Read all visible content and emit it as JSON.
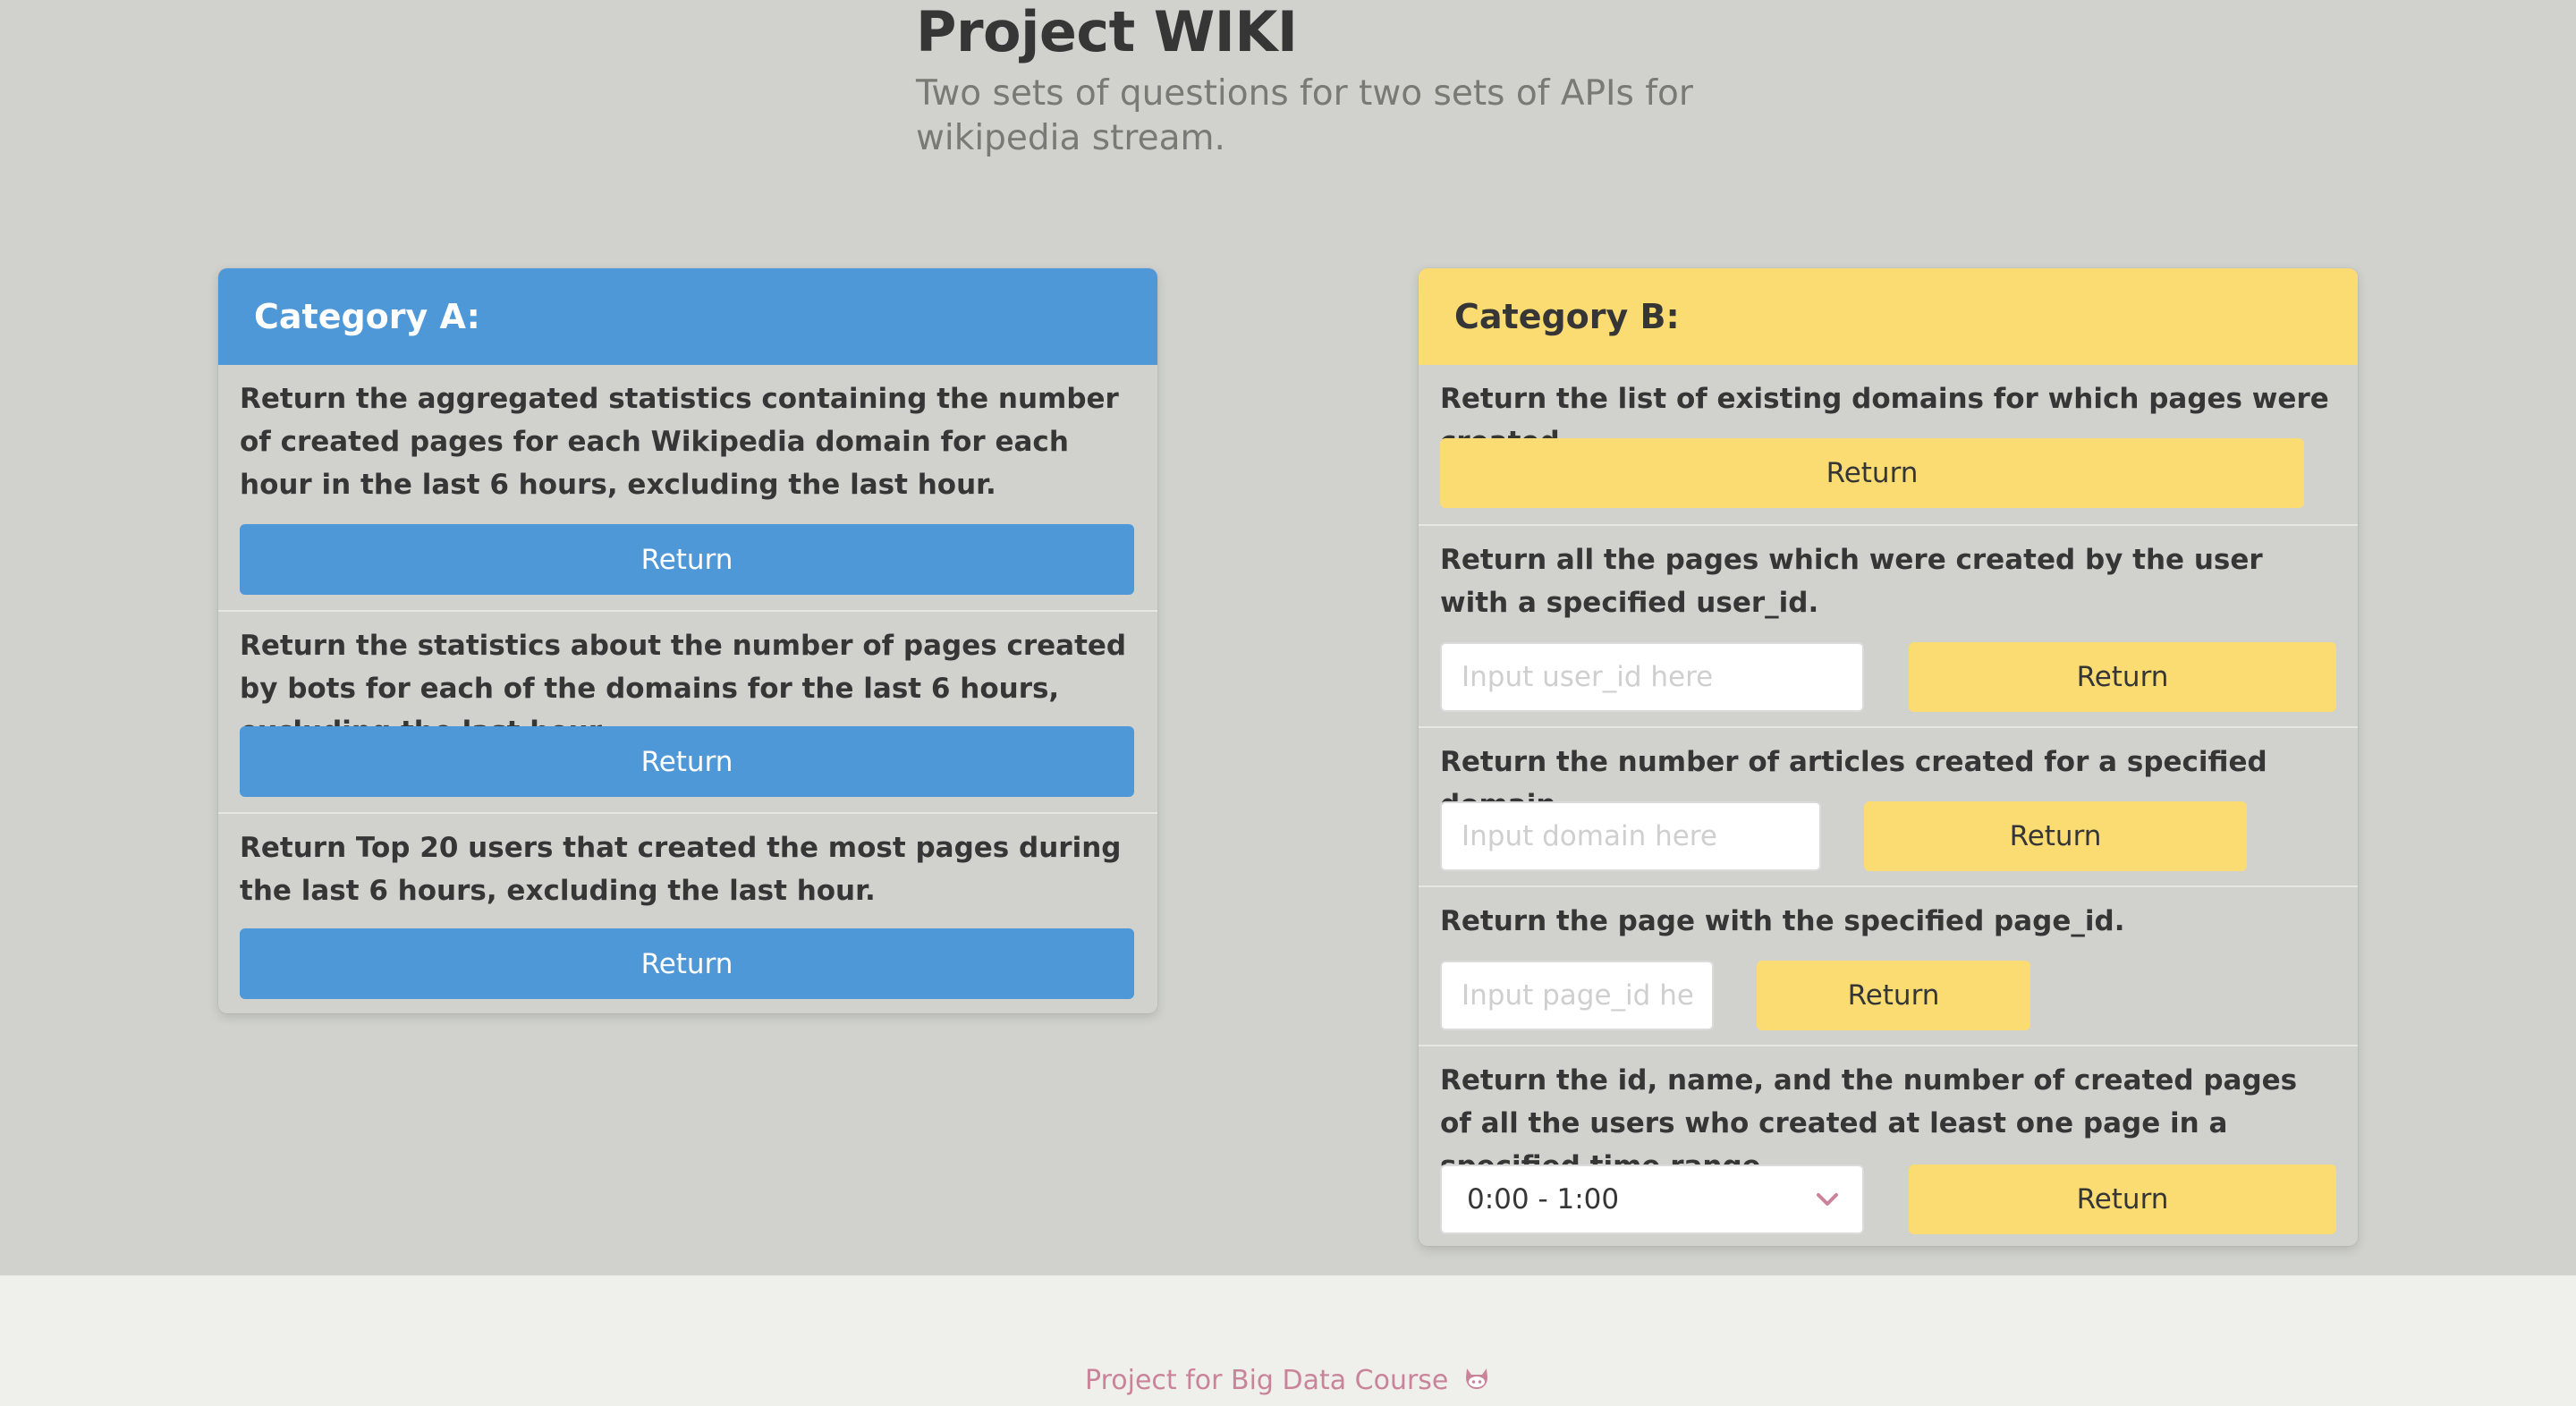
{
  "header": {
    "title": "Project WIKI",
    "subtitle": "Two sets of questions for two sets of APIs for wikipedia stream."
  },
  "category_a": {
    "title": "Category A:",
    "accent_color": "#4f98d8",
    "items": [
      {
        "question": "Return the aggregated statistics containing the number of created pages for each Wikipedia domain for each hour in the last 6 hours, excluding the last hour.",
        "button": "Return"
      },
      {
        "question": "Return the statistics about the number of pages created by bots for each of the domains for the last 6 hours, excluding the last hour.",
        "button": "Return"
      },
      {
        "question": "Return Top 20 users that created the most pages during the last 6 hours, excluding the last hour.",
        "button": "Return"
      }
    ]
  },
  "category_b": {
    "title": "Category B:",
    "accent_color": "#fadc72",
    "items": [
      {
        "question": "Return the list of existing domains for which pages were created.",
        "button": "Return"
      },
      {
        "question": "Return all the pages which were created by the user with a specified user_id.",
        "input_placeholder": "Input user_id here",
        "input_value": "",
        "button": "Return"
      },
      {
        "question": "Return the number of articles created for a specified domain.",
        "input_placeholder": "Input domain here",
        "input_value": "",
        "button": "Return"
      },
      {
        "question": "Return the page with the specified page_id.",
        "input_placeholder": "Input page_id here",
        "input_value": "",
        "button": "Return"
      },
      {
        "question": "Return the id, name, and the number of created pages of all the users who created at least one page in a specified time range.",
        "select_value": "0:00 - 1:00",
        "button": "Return"
      }
    ]
  },
  "footer": {
    "text": "Project for Big Data Course",
    "icon": "github-icon",
    "link_color": "#c9849a"
  }
}
